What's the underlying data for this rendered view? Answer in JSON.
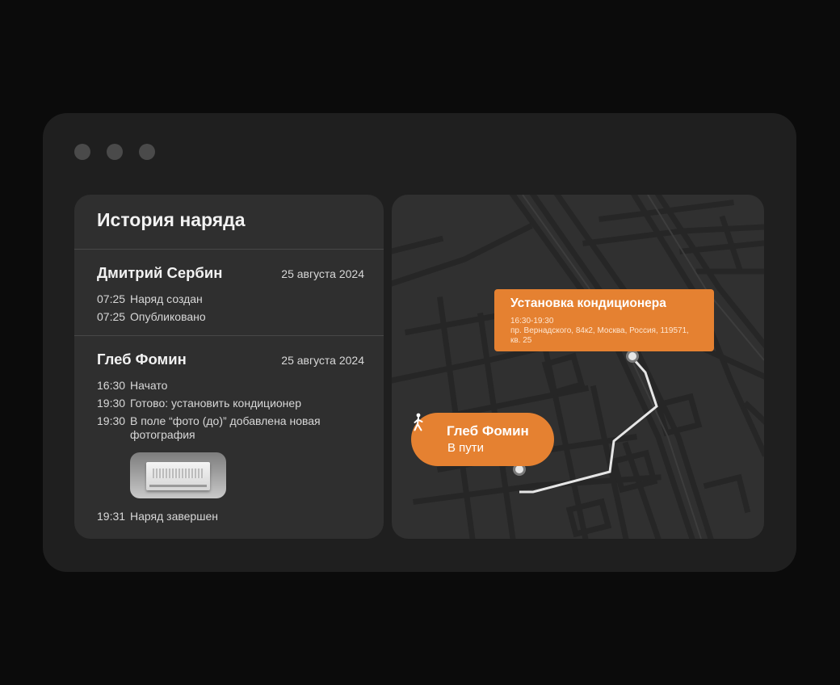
{
  "history": {
    "title": "История наряда",
    "entries": [
      {
        "name": "Дмитрий Сербин",
        "date": "25 августа 2024",
        "events": [
          {
            "time": "07:25",
            "text": "Наряд создан"
          },
          {
            "time": "07:25",
            "text": "Опубликовано"
          }
        ]
      },
      {
        "name": "Глеб Фомин",
        "date": "25 августа 2024",
        "events": [
          {
            "time": "16:30",
            "text": "Начато"
          },
          {
            "time": "19:30",
            "text": "Готово: установить кондиционер"
          },
          {
            "time": "19:30",
            "text": "В поле “фото (до)” добавлена новая фотография"
          },
          {
            "time": "19:31",
            "text": "Наряд завершен"
          }
        ],
        "photo_icon": "air-conditioner-photo"
      }
    ]
  },
  "map": {
    "task": {
      "title": "Установка кондиционера",
      "time": "16:30-19:30",
      "address": "пр. Вернадского, 84к2, Москва, Россия, 119571, кв. 25"
    },
    "worker": {
      "name": "Глеб Фомин",
      "status": "В пути",
      "icon": "walking-person-icon"
    }
  },
  "colors": {
    "accent": "#e58131",
    "panel": "#2f2f2f",
    "window": "#1f1f1f",
    "background": "#0b0b0b"
  }
}
